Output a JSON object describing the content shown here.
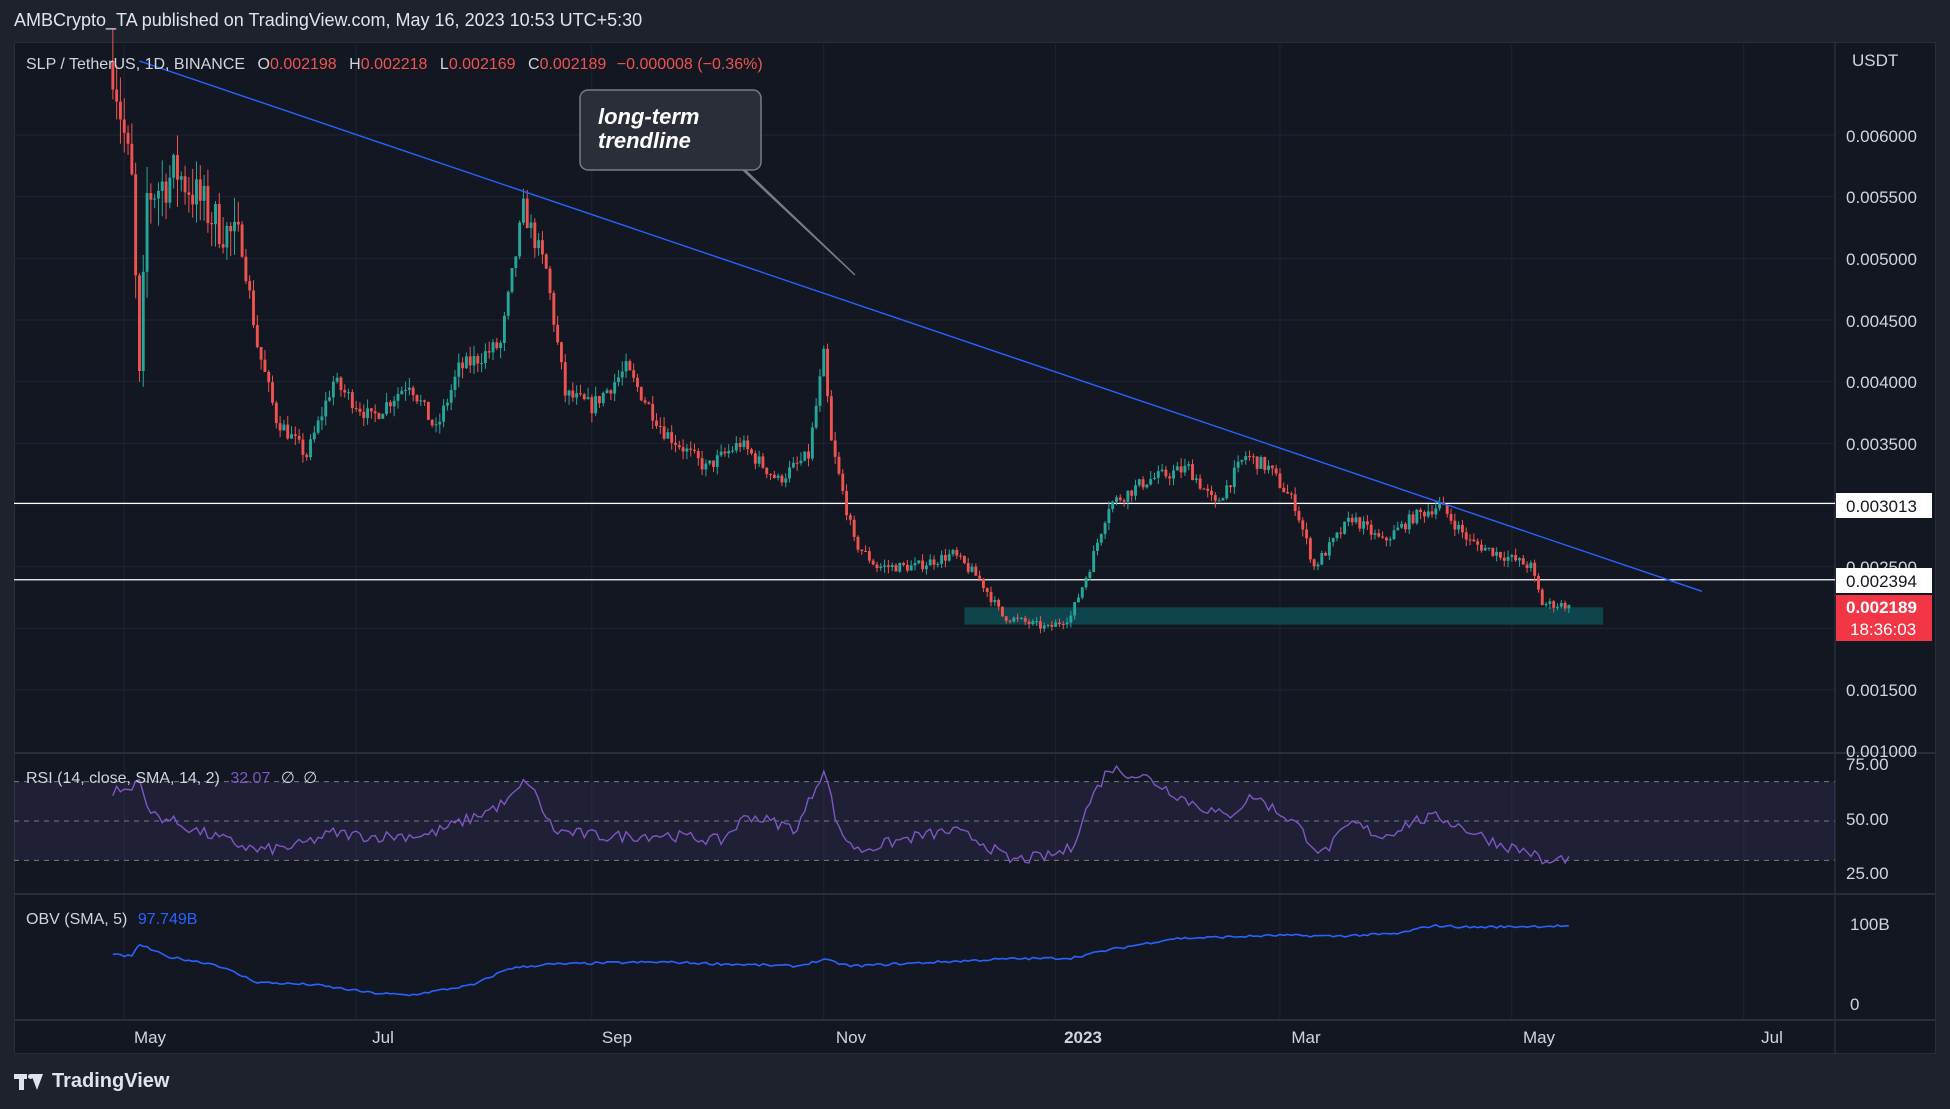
{
  "header": {
    "published": "AMBCrypto_TA published on TradingView.com, May 16, 2023 10:53 UTC+5:30"
  },
  "legend": {
    "symbol": "SLP / TetherUS, 1D, BINANCE",
    "o_label": "O",
    "o": "0.002198",
    "h_label": "H",
    "h": "0.002218",
    "l_label": "L",
    "l": "0.002169",
    "c_label": "C",
    "c": "0.002189",
    "change": "−0.000008 (−0.36%)"
  },
  "annotation": {
    "line1": "long-term",
    "line2": "trendline"
  },
  "price_axis": {
    "currency": "USDT",
    "ticks": [
      "0.006000",
      "0.005500",
      "0.005000",
      "0.004500",
      "0.004000",
      "0.003500",
      "0.002500",
      "0.001500",
      "0.001000"
    ],
    "level_1": "0.003013",
    "level_2": "0.002394",
    "last_price": "0.002189",
    "countdown": "18:36:03"
  },
  "rsi": {
    "label": "RSI (14, close, SMA, 14, 2)",
    "value": "32.07",
    "na1": "∅",
    "na2": "∅",
    "ticks": [
      "75.00",
      "50.00",
      "25.00"
    ]
  },
  "obv": {
    "label": "OBV (SMA, 5)",
    "value": "97.749B",
    "ticks": [
      "100B",
      "0"
    ]
  },
  "time_axis": [
    "May",
    "Jul",
    "Sep",
    "Nov",
    "2023",
    "Mar",
    "May",
    "Jul"
  ],
  "footer": {
    "brand": "TradingView"
  },
  "colors": {
    "background": "#131722",
    "up": "#26a69a",
    "down": "#ef5350",
    "trendline": "#2962ff",
    "rsi": "#7e57c2",
    "obv": "#2962ff",
    "support_zone": "#0e4a52"
  },
  "chart_data": {
    "type": "candlestick",
    "symbol": "SLP/USDT",
    "interval": "1D",
    "ylim": [
      0.00095,
      0.0066
    ],
    "price_path": [
      [
        "2022-04-28",
        0.0066
      ],
      [
        "2022-05-03",
        0.0056
      ],
      [
        "2022-05-05",
        0.004
      ],
      [
        "2022-05-07",
        0.0055
      ],
      [
        "2022-05-15",
        0.0057
      ],
      [
        "2022-05-25",
        0.0053
      ],
      [
        "2022-06-01",
        0.0051
      ],
      [
        "2022-06-05",
        0.0043
      ],
      [
        "2022-06-10",
        0.0037
      ],
      [
        "2022-06-18",
        0.0034
      ],
      [
        "2022-06-25",
        0.004
      ],
      [
        "2022-07-05",
        0.0037
      ],
      [
        "2022-07-15",
        0.004
      ],
      [
        "2022-07-22",
        0.0036
      ],
      [
        "2022-07-28",
        0.0041
      ],
      [
        "2022-08-08",
        0.0043
      ],
      [
        "2022-08-14",
        0.0054
      ],
      [
        "2022-08-20",
        0.0049
      ],
      [
        "2022-08-25",
        0.0039
      ],
      [
        "2022-09-01",
        0.0038
      ],
      [
        "2022-09-10",
        0.0041
      ],
      [
        "2022-09-20",
        0.0036
      ],
      [
        "2022-10-01",
        0.0033
      ],
      [
        "2022-10-10",
        0.0035
      ],
      [
        "2022-10-20",
        0.0032
      ],
      [
        "2022-10-28",
        0.0034
      ],
      [
        "2022-11-01",
        0.0042
      ],
      [
        "2022-11-03",
        0.0035
      ],
      [
        "2022-11-09",
        0.0027
      ],
      [
        "2022-11-15",
        0.0025
      ],
      [
        "2022-11-25",
        0.0025
      ],
      [
        "2022-12-05",
        0.0026
      ],
      [
        "2022-12-12",
        0.0024
      ],
      [
        "2022-12-18",
        0.0021
      ],
      [
        "2022-12-30",
        0.002
      ],
      [
        "2023-01-05",
        0.0021
      ],
      [
        "2023-01-10",
        0.0025
      ],
      [
        "2023-01-15",
        0.003
      ],
      [
        "2023-01-25",
        0.0032
      ],
      [
        "2023-02-05",
        0.0033
      ],
      [
        "2023-02-12",
        0.003
      ],
      [
        "2023-02-20",
        0.0034
      ],
      [
        "2023-02-26",
        0.0033
      ],
      [
        "2023-03-05",
        0.003
      ],
      [
        "2023-03-10",
        0.0025
      ],
      [
        "2023-03-20",
        0.0029
      ],
      [
        "2023-03-28",
        0.0027
      ],
      [
        "2023-04-05",
        0.0029
      ],
      [
        "2023-04-12",
        0.003
      ],
      [
        "2023-04-20",
        0.0027
      ],
      [
        "2023-04-28",
        0.0026
      ],
      [
        "2023-05-06",
        0.0025
      ],
      [
        "2023-05-09",
        0.0022
      ],
      [
        "2023-05-16",
        0.002189
      ]
    ],
    "trendline": [
      [
        "2022-05-05",
        0.0066
      ],
      [
        "2023-06-20",
        0.0023
      ]
    ],
    "horizontal_levels": [
      0.003013,
      0.002394
    ],
    "support_zone": {
      "from": "2022-12-08",
      "to": "2023-05-25",
      "low": 0.00203,
      "high": 0.00217
    },
    "rsi_points": [
      [
        "2022-04-28",
        65
      ],
      [
        "2022-05-03",
        66
      ],
      [
        "2022-05-05",
        74
      ],
      [
        "2022-05-07",
        55
      ],
      [
        "2022-05-20",
        45
      ],
      [
        "2022-06-05",
        35
      ],
      [
        "2022-06-15",
        37
      ],
      [
        "2022-06-25",
        44
      ],
      [
        "2022-07-05",
        42
      ],
      [
        "2022-07-20",
        43
      ],
      [
        "2022-08-01",
        52
      ],
      [
        "2022-08-10",
        60
      ],
      [
        "2022-08-15",
        71
      ],
      [
        "2022-08-22",
        45
      ],
      [
        "2022-09-05",
        42
      ],
      [
        "2022-09-20",
        43
      ],
      [
        "2022-10-05",
        40
      ],
      [
        "2022-10-12",
        53
      ],
      [
        "2022-10-25",
        46
      ],
      [
        "2022-11-01",
        77
      ],
      [
        "2022-11-05",
        45
      ],
      [
        "2022-11-10",
        35
      ],
      [
        "2022-11-25",
        42
      ],
      [
        "2022-12-05",
        45
      ],
      [
        "2022-12-12",
        40
      ],
      [
        "2022-12-20",
        30
      ],
      [
        "2022-12-30",
        32
      ],
      [
        "2023-01-05",
        36
      ],
      [
        "2023-01-10",
        60
      ],
      [
        "2023-01-15",
        77
      ],
      [
        "2023-01-25",
        72
      ],
      [
        "2023-02-05",
        60
      ],
      [
        "2023-02-15",
        52
      ],
      [
        "2023-02-22",
        63
      ],
      [
        "2023-03-05",
        49
      ],
      [
        "2023-03-12",
        33
      ],
      [
        "2023-03-20",
        49
      ],
      [
        "2023-03-28",
        42
      ],
      [
        "2023-04-05",
        50
      ],
      [
        "2023-04-12",
        52
      ],
      [
        "2023-04-20",
        45
      ],
      [
        "2023-04-28",
        38
      ],
      [
        "2023-05-06",
        34
      ],
      [
        "2023-05-10",
        28
      ],
      [
        "2023-05-16",
        32
      ]
    ],
    "rsi_levels": [
      70,
      50,
      30
    ],
    "obv_points": [
      [
        "2022-04-28",
        62
      ],
      [
        "2022-05-03",
        60
      ],
      [
        "2022-05-05",
        75
      ],
      [
        "2022-05-12",
        60
      ],
      [
        "2022-05-25",
        50
      ],
      [
        "2022-06-05",
        28
      ],
      [
        "2022-06-20",
        25
      ],
      [
        "2022-07-05",
        15
      ],
      [
        "2022-07-15",
        12
      ],
      [
        "2022-08-01",
        25
      ],
      [
        "2022-08-10",
        45
      ],
      [
        "2022-08-20",
        50
      ],
      [
        "2022-09-05",
        52
      ],
      [
        "2022-09-20",
        53
      ],
      [
        "2022-10-10",
        50
      ],
      [
        "2022-10-25",
        48
      ],
      [
        "2022-11-01",
        56
      ],
      [
        "2022-11-08",
        48
      ],
      [
        "2022-12-01",
        53
      ],
      [
        "2022-12-20",
        57
      ],
      [
        "2023-01-05",
        58
      ],
      [
        "2023-01-15",
        68
      ],
      [
        "2023-02-01",
        82
      ],
      [
        "2023-02-15",
        84
      ],
      [
        "2023-03-01",
        86
      ],
      [
        "2023-03-15",
        85
      ],
      [
        "2023-04-01",
        88
      ],
      [
        "2023-04-10",
        98
      ],
      [
        "2023-04-20",
        96
      ],
      [
        "2023-05-16",
        97.7
      ]
    ],
    "obv_ylim": [
      -10,
      110
    ]
  }
}
